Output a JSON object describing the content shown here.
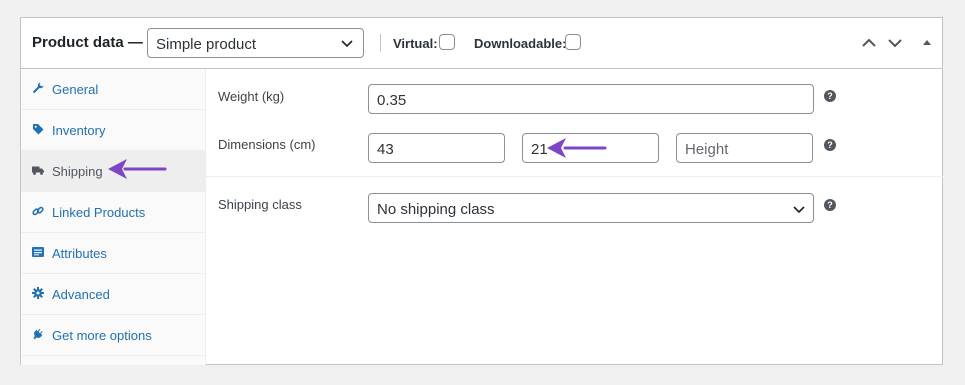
{
  "header": {
    "title": "Product data —",
    "product_type": "Simple product",
    "virtual_label": "Virtual:",
    "downloadable_label": "Downloadable:"
  },
  "sidebar": {
    "items": [
      {
        "label": "General",
        "icon": "wrench-icon"
      },
      {
        "label": "Inventory",
        "icon": "tag-icon"
      },
      {
        "label": "Shipping",
        "icon": "truck-icon",
        "active": true
      },
      {
        "label": "Linked Products",
        "icon": "link-icon"
      },
      {
        "label": "Attributes",
        "icon": "list-icon"
      },
      {
        "label": "Advanced",
        "icon": "gear-icon"
      },
      {
        "label": "Get more options",
        "icon": "plugin-icon"
      }
    ]
  },
  "shipping": {
    "weight_label": "Weight (kg)",
    "weight_value": "0.35",
    "dimensions_label": "Dimensions (cm)",
    "length_value": "43",
    "width_value": "21",
    "height_placeholder": "Height",
    "shipping_class_label": "Shipping class",
    "shipping_class_value": "No shipping class",
    "help_glyph": "?"
  },
  "colors": {
    "link": "#2271b1",
    "annotation_arrow": "#7e46c7"
  }
}
